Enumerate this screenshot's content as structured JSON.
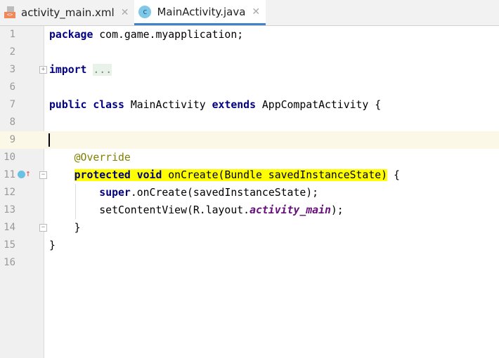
{
  "tabs": [
    {
      "label": "activity_main.xml",
      "icon": "xml-file-icon",
      "icon_text": "<>",
      "active": false
    },
    {
      "label": "MainActivity.java",
      "icon": "java-class-icon",
      "icon_text": "c",
      "active": true
    }
  ],
  "close_glyph": "✕",
  "lines": {
    "1": {
      "n": "1",
      "a": "package",
      "b": " com.game.myapplication;"
    },
    "2": {
      "n": "2"
    },
    "3": {
      "n": "3",
      "a": "import",
      "b": " ",
      "c": "..."
    },
    "6": {
      "n": "6"
    },
    "7": {
      "n": "7",
      "a": "public class",
      "b": " MainActivity ",
      "c": "extends",
      "d": " AppCompatActivity {"
    },
    "8": {
      "n": "8"
    },
    "9": {
      "n": "9"
    },
    "10": {
      "n": "10",
      "a": "    ",
      "b": "@Override"
    },
    "11": {
      "n": "11",
      "a": "    ",
      "b": "protected void",
      "c": " onCreate(Bundle savedInstanceState)",
      "d": " {"
    },
    "12": {
      "n": "12",
      "a": "        ",
      "b": "super",
      "c": ".onCreate(savedInstanceState);"
    },
    "13": {
      "n": "13",
      "a": "        setContentView(R.layout.",
      "b": "activity_main",
      "c": ");"
    },
    "14": {
      "n": "14",
      "a": "    }"
    },
    "15": {
      "n": "15",
      "a": "}"
    },
    "16": {
      "n": "16"
    }
  },
  "fold_glyph": "−",
  "fold_plus": "+",
  "colors": {
    "keyword": "#000080",
    "annotation": "#808000",
    "field": "#660e7a",
    "highlight": "#ffff00",
    "tab_accent": "#4083c9"
  }
}
